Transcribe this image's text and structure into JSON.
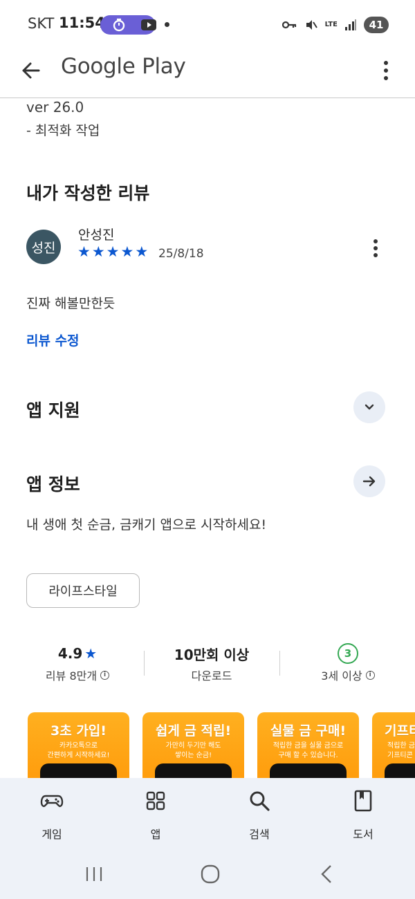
{
  "status_bar": {
    "carrier": "SKT",
    "time": "11:54",
    "network": "LTE",
    "battery": "41"
  },
  "header": {
    "title": "Google Play"
  },
  "whats_new": {
    "version": "ver 26.0",
    "note": "- 최적화 작업"
  },
  "my_review": {
    "section_title": "내가 작성한 리뷰",
    "avatar_text": "성진",
    "reviewer_name": "안성진",
    "rating": 5,
    "stars": [
      "★",
      "★",
      "★",
      "★",
      "★"
    ],
    "date": "25/8/18",
    "text": "진짜 해볼만한듯",
    "edit_label": "리뷰 수정"
  },
  "app_support": {
    "title": "앱 지원"
  },
  "app_info": {
    "title": "앱 정보",
    "description": "내 생애 첫 순금, 금캐기 앱으로 시작하세요!",
    "category_chip": "라이프스타일"
  },
  "stats": {
    "rating_value": "4.9",
    "rating_star": "★",
    "reviews_label": "리뷰 8만개",
    "downloads_value": "10만회 이상",
    "downloads_label": "다운로드",
    "age_badge": "3",
    "age_label": "3세 이상"
  },
  "screenshots": [
    {
      "title": "3초 가입!",
      "subtitle": "카카오톡으로\n간편하게 시작하세요!"
    },
    {
      "title": "쉽게 금 적립!",
      "subtitle": "가만히 두기만 해도\n쌓이는 순금!"
    },
    {
      "title": "실물 금 구매!",
      "subtitle": "적립한 금을 실물 금으로\n구매 할 수 있습니다."
    },
    {
      "title": "기프티",
      "subtitle": "적립한 금\n기프티콘"
    }
  ],
  "bottom_nav": {
    "games": "게임",
    "apps": "앱",
    "search": "검색",
    "books": "도서"
  },
  "colors": {
    "accent_blue": "#0b57d0",
    "avatar_bg": "#3b5663",
    "age_green": "#34a853",
    "screenshot_orange": "#ffa515",
    "nav_bg": "#eef2f8"
  }
}
